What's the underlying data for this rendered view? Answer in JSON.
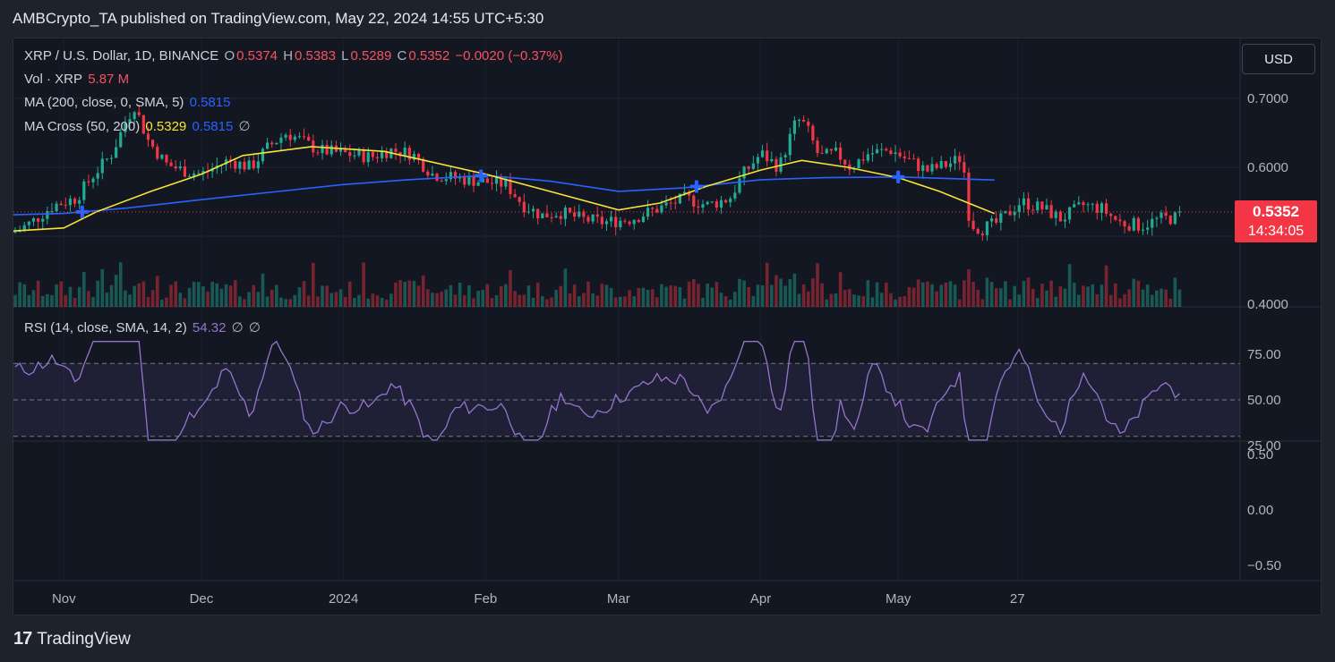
{
  "header": {
    "text": "AMBCrypto_TA published on TradingView.com, May 22, 2024 14:55 UTC+5:30"
  },
  "legend": {
    "symbol": "XRP / U.S. Dollar, 1D, BINANCE",
    "o_label": "O",
    "o": "0.5374",
    "h_label": "H",
    "h": "0.5383",
    "l_label": "L",
    "l": "0.5289",
    "c_label": "C",
    "c": "0.5352",
    "change": "−0.0020 (−0.37%)",
    "vol_label": "Vol · XRP",
    "vol": "5.87 M",
    "ma_label": "MA (200, close, 0, SMA, 5)",
    "ma": "0.5815",
    "cross_label": "MA Cross (50, 200)",
    "cross_fast": "0.5329",
    "cross_slow": "0.5815",
    "cross_extra": "∅",
    "rsi_label": "RSI (14, close, SMA, 14, 2)",
    "rsi": "54.32",
    "rsi_extra1": "∅",
    "rsi_extra2": "∅"
  },
  "currency_button": "USD",
  "last_price": {
    "value": "0.5352",
    "countdown": "14:34:05"
  },
  "footer": {
    "logo": "17",
    "brand": "TradingView"
  },
  "colors": {
    "up": "#22ab94",
    "down": "#f23645",
    "ma200": "#2962ff",
    "ma50": "#f7e436",
    "rsi": "#9575cd"
  },
  "chart_data": [
    {
      "type": "candlestick",
      "title": "XRP / U.S. Dollar, 1D, BINANCE",
      "x_ticks": [
        "Nov",
        "Dec",
        "2024",
        "Feb",
        "Mar",
        "Apr",
        "May",
        "27"
      ],
      "y_ticks": [
        "0.7000",
        "0.6000",
        "0.5352",
        "0.4000"
      ],
      "ylim": [
        0.4,
        0.74
      ],
      "ohlc": {
        "open": 0.5374,
        "high": 0.5383,
        "low": 0.5289,
        "close": 0.5352
      },
      "series": [
        {
          "name": "MA (200, close, 0, SMA, 5)",
          "last": 0.5815,
          "points": [
            [
              "Oct 15",
              0.53
            ],
            [
              "Nov 1",
              0.533
            ],
            [
              "Nov 15",
              0.541
            ],
            [
              "Dec 1",
              0.553
            ],
            [
              "Dec 15",
              0.563
            ],
            [
              "Jan 1",
              0.575
            ],
            [
              "Jan 15",
              0.582
            ],
            [
              "Feb 1",
              0.588
            ],
            [
              "Feb 15",
              0.58
            ],
            [
              "Mar 1",
              0.565
            ],
            [
              "Mar 15",
              0.57
            ],
            [
              "Apr 1",
              0.582
            ],
            [
              "Apr 15",
              0.585
            ],
            [
              "May 1",
              0.586
            ],
            [
              "May 22",
              0.5815
            ]
          ]
        },
        {
          "name": "MA Cross (50, 200)",
          "last": 0.5329,
          "points": [
            [
              "Oct 15",
              0.505
            ],
            [
              "Nov 1",
              0.512
            ],
            [
              "Nov 8",
              0.535
            ],
            [
              "Nov 20",
              0.565
            ],
            [
              "Dec 1",
              0.59
            ],
            [
              "Dec 10",
              0.617
            ],
            [
              "Dec 25",
              0.63
            ],
            [
              "Jan 10",
              0.623
            ],
            [
              "Jan 20",
              0.608
            ],
            [
              "Feb 1",
              0.59
            ],
            [
              "Feb 15",
              0.565
            ],
            [
              "Mar 1",
              0.538
            ],
            [
              "Mar 10",
              0.548
            ],
            [
              "Mar 20",
              0.572
            ],
            [
              "Apr 1",
              0.596
            ],
            [
              "Apr 10",
              0.61
            ],
            [
              "Apr 20",
              0.6
            ],
            [
              "May 1",
              0.585
            ],
            [
              "May 10",
              0.565
            ],
            [
              "May 22",
              0.5329
            ]
          ]
        }
      ],
      "crosses": [
        "Nov 5",
        "Jan 31",
        "Mar 18",
        "May 1"
      ]
    },
    {
      "type": "line",
      "title": "RSI (14, close, SMA, 14, 2)",
      "y_ticks": [
        "75.00",
        "50.00",
        "25.00"
      ],
      "bands": [
        70,
        50,
        30
      ],
      "ylim": [
        20,
        80
      ],
      "last": 54.32
    },
    {
      "type": "line",
      "y_ticks": [
        "0.50",
        "0.00",
        "−0.50"
      ],
      "ylim": [
        -0.75,
        0.75
      ]
    }
  ]
}
